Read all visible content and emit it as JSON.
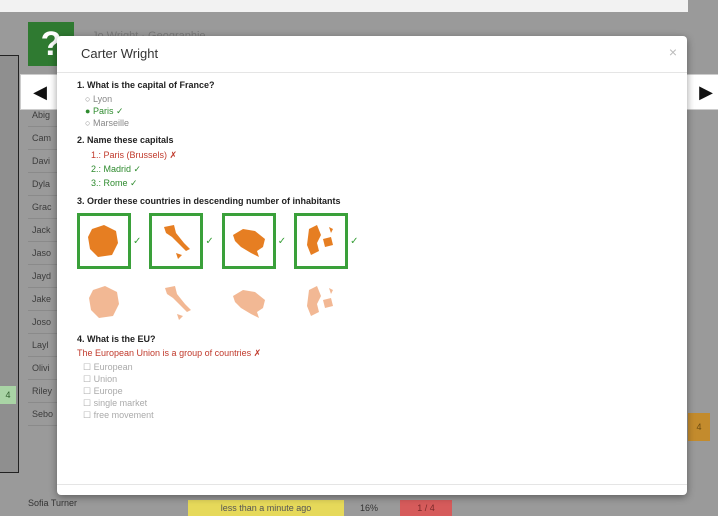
{
  "background": {
    "header_text": "Jo Wright · Geographie",
    "logo_glyph": "?",
    "rows": [
      "Abig",
      "Cam",
      "Davi",
      "Dyla",
      "Grac",
      "Jack",
      "Jaso",
      "Jayd",
      "Jake",
      "Joso",
      "Layl",
      "Olivi",
      "Riley",
      "Sebo"
    ],
    "bottom_name": "Sofia Turner",
    "bottom_time": "less than a minute ago",
    "bottom_pct": "16%",
    "bottom_score": "1 / 4",
    "green_badge": "4",
    "orange_badge": "4"
  },
  "nav": {
    "left_glyph": "◀",
    "right_glyph": "▶"
  },
  "modal": {
    "title": "Carter Wright",
    "close_glyph": "×",
    "q1": {
      "title": "1. What is the capital of France?",
      "options": [
        {
          "text": "Lyon",
          "marker": "○",
          "state": "none"
        },
        {
          "text": "Paris ✓",
          "marker": "●",
          "state": "correct"
        },
        {
          "text": "Marseille",
          "marker": "○",
          "state": "none"
        }
      ]
    },
    "q2": {
      "title": "2. Name these capitals",
      "answers": [
        {
          "num": "1.",
          "text": ": Paris (Brussels) ✗",
          "state": "wrong"
        },
        {
          "num": "2.",
          "text": ": Madrid ✓",
          "state": "correct"
        },
        {
          "num": "3.",
          "text": ": Rome ✓",
          "state": "correct"
        }
      ]
    },
    "q3": {
      "title": "3. Order these countries in descending number of inhabitants",
      "check": "✓",
      "map_color": "#e67e22",
      "ghost_color": "#f2b894"
    },
    "q4": {
      "title": "4. What is the EU?",
      "answer": "The European Union is a group of countries ✗",
      "options": [
        "European",
        "Union",
        "Europe",
        "single market",
        "free movement"
      ]
    }
  }
}
